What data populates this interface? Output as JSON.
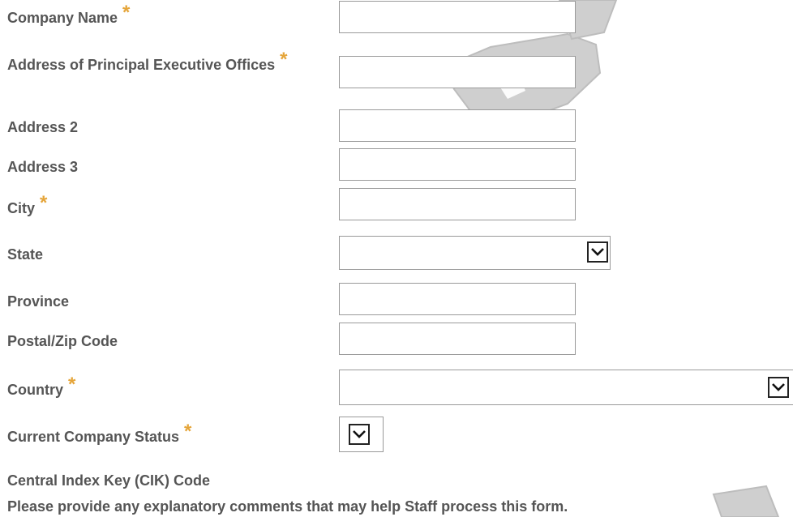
{
  "form": {
    "required_mark": "*",
    "fields": {
      "company_name": {
        "label": "Company Name",
        "value": ""
      },
      "address_principal": {
        "label": "Address of Principal Executive Offices",
        "value": ""
      },
      "address2": {
        "label": "Address 2",
        "value": ""
      },
      "address3": {
        "label": "Address 3",
        "value": ""
      },
      "city": {
        "label": "City",
        "value": ""
      },
      "state": {
        "label": "State",
        "selected": ""
      },
      "province": {
        "label": "Province",
        "value": ""
      },
      "postal_zip": {
        "label": "Postal/Zip Code",
        "value": ""
      },
      "country": {
        "label": "Country",
        "selected": ""
      },
      "company_status": {
        "label": "Current Company Status",
        "selected": ""
      },
      "cik_code": {
        "label": "Central Index Key (CIK) Code"
      }
    },
    "comments_prompt": "Please provide any explanatory comments that may help Staff process this form."
  },
  "colors": {
    "label_text": "#555555",
    "required_star": "#E5A53A",
    "field_border": "#9a9a9a",
    "watermark": "#c8c8c8"
  },
  "icons": {
    "select_caret": "chevron-down-icon"
  }
}
